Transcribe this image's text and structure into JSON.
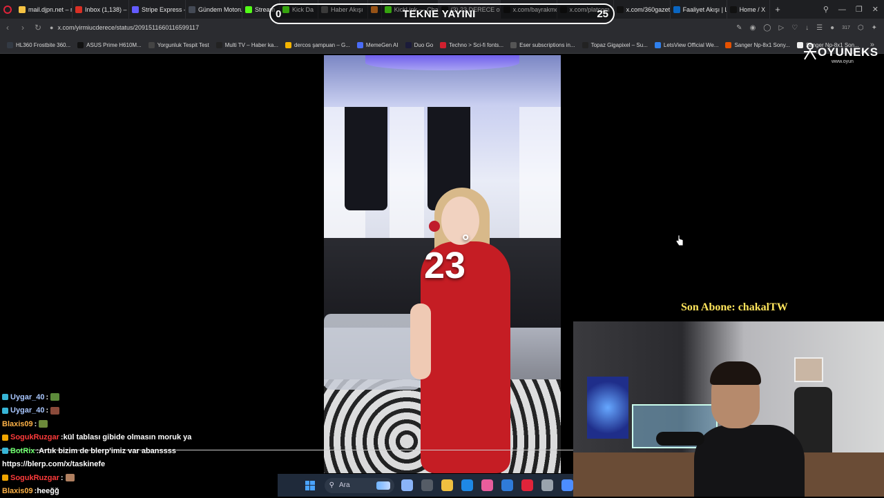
{
  "browser": {
    "tabs": [
      {
        "label": "mail.djpn.net – m",
        "color": "#f6c343"
      },
      {
        "label": "Inbox (1,138) – k",
        "color": "#d93025"
      },
      {
        "label": "Stripe Express – ",
        "color": "#635bff"
      },
      {
        "label": "Gündem Motoru",
        "color": "#444a55"
      },
      {
        "label": "Stream",
        "color": "#53fc18"
      },
      {
        "label": "Kick Da",
        "color": "#53fc18"
      },
      {
        "label": "Haber Akışı",
        "color": "#5a5a5a"
      },
      {
        "label": "",
        "color": "#e67e22"
      },
      {
        "label": "KickLink — Chat",
        "color": "#53fc18"
      },
      {
        "label": "(3) 23 DERECE on X: \"Go",
        "color": "#111111",
        "active": true
      },
      {
        "label": "x.com/bayrakmer",
        "color": "#111111"
      },
      {
        "label": "x.com/platcom",
        "color": "#111111"
      },
      {
        "label": "x.com/360gazete",
        "color": "#111111"
      },
      {
        "label": "Faaliyet Akışı | Lin",
        "color": "#0a66c2"
      },
      {
        "label": "Home / X",
        "color": "#111111"
      }
    ],
    "new_tab": "+",
    "url": "x.com/yirmiucderece/status/2091511660116599117",
    "bookmarks": [
      {
        "label": "HL360 Frostbite 360...",
        "color": "#333a44"
      },
      {
        "label": "ASUS Prime H610M...",
        "color": "#111111"
      },
      {
        "label": "Yorgunluk Tespit Test",
        "color": "#444444"
      },
      {
        "label": "Multi TV – Haber ka...",
        "color": "#222222"
      },
      {
        "label": "dercos şampuan – G...",
        "color": "#f4b400"
      },
      {
        "label": "MemeGen AI",
        "color": "#4a6cf7"
      },
      {
        "label": "Duo Go",
        "color": "#1b1b3a"
      },
      {
        "label": "Techno > Sci-fi fonts...",
        "color": "#d1202f"
      },
      {
        "label": "Eser subscriptions in...",
        "color": "#555555"
      },
      {
        "label": "Topaz Gigapixel – Su...",
        "color": "#222222"
      },
      {
        "label": "LetsView Official We...",
        "color": "#2f80ed"
      },
      {
        "label": "Sanger Np-8x1 Sony...",
        "color": "#e65100"
      },
      {
        "label": "Sanger Np-8x1 Son...",
        "color": "#eeeeee"
      }
    ],
    "badge_count": "317"
  },
  "overlay": {
    "score_left": "0",
    "score_right": "25",
    "score_title": "TEKNE YAYINI",
    "brand_name": "OYUNEKS",
    "brand_sub": "www.oyun",
    "temp_value": "23",
    "temp_unit": "°",
    "last_sub": "Son Abone: chakalTW"
  },
  "chat": [
    {
      "user": "Uygar_40",
      "sep": " :",
      "text": "",
      "color": "#a9c7ff",
      "badge": "#37b5d6",
      "emote": "#5c8a3a"
    },
    {
      "user": "Uygar_40",
      "sep": " :",
      "text": "",
      "color": "#a9c7ff",
      "badge": "#37b5d6",
      "emote": "#8a4a3a"
    },
    {
      "user": "Blaxis09",
      "sep": " :",
      "text": "",
      "color": "#ffb347",
      "badge": "",
      "emote": "#6c8a3a"
    },
    {
      "user": "SogukRuzgar",
      "sep": " :",
      "text": " kül tablası gibide olmasın moruk ya",
      "color": "#ff3b3b",
      "badge": "#f0a500",
      "emote": ""
    },
    {
      "user": "BotRix",
      "sep": " :",
      "text": " Artık bizim de blerp'imiz var abanssss",
      "color": "#6cff6c",
      "badge": "#37b5d6",
      "emote": ""
    },
    {
      "user": "",
      "sep": "",
      "text": "https://blerp.com/x/taskinefe",
      "color": "#ffffff",
      "badge": "",
      "emote": ""
    },
    {
      "user": "SogukRuzgar",
      "sep": " :",
      "text": "",
      "color": "#ff3b3b",
      "badge": "#f0a500",
      "emote": "#b08060"
    },
    {
      "user": "Blaxis09",
      "sep": " :",
      "text": " heeğğ",
      "color": "#ffb347",
      "badge": "",
      "emote": ""
    }
  ],
  "taskbar": {
    "search_placeholder": "Ara",
    "apps": [
      "#8ab4f8",
      "#555c66",
      "#f0c040",
      "#1e88e5",
      "#e85d9c",
      "#2f7bd9",
      "#e0243a",
      "#9aa3ad",
      "#4c8dff"
    ]
  }
}
